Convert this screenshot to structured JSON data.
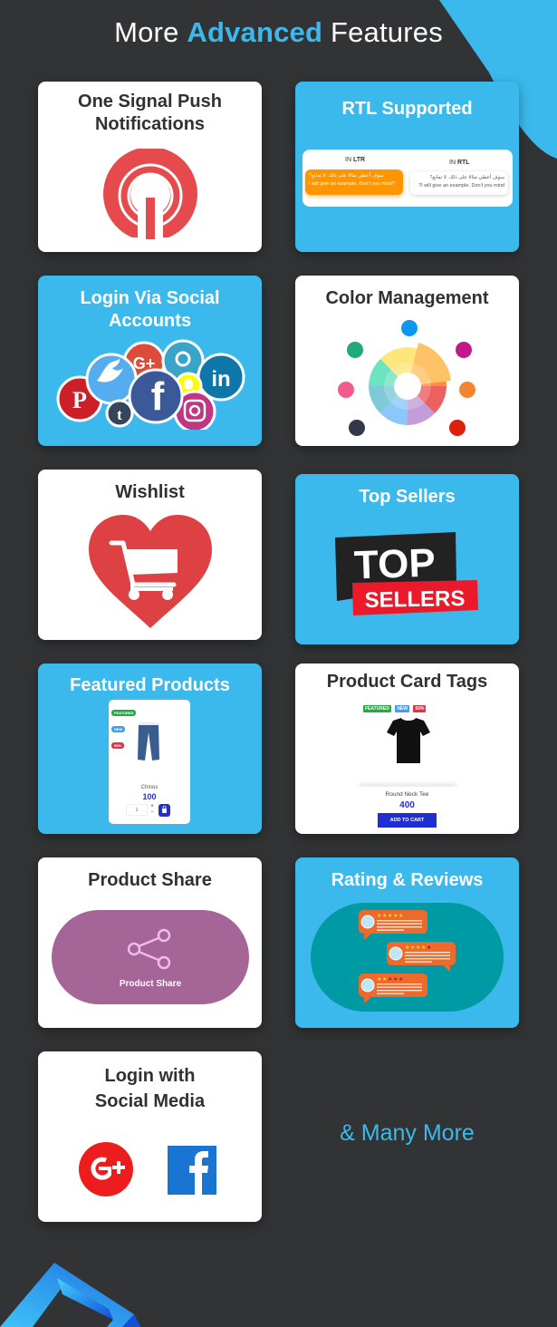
{
  "header": {
    "title_prefix": "More",
    "title_accent": "Advanced",
    "title_suffix": "Features"
  },
  "colors": {
    "background": "#313335",
    "accent_blue": "#3bb9ec",
    "card_white": "#ffffff",
    "title_dark": "#2f3133"
  },
  "features": [
    {
      "title_line1": "One Signal Push",
      "title_line2": "Notifications",
      "icon": "onesignal-bell-icon",
      "style": "white"
    },
    {
      "title": "RTL Supported",
      "icon": "rtl-demo",
      "style": "blue",
      "demo": {
        "ltr_label_prefix": "IN",
        "ltr_label_strong": "LTR",
        "rtl_label_prefix": "IN",
        "rtl_label_strong": "RTL",
        "ltr_arabic": "?سوف أعطي مثالا على ذلك. لا تمانع",
        "ltr_english": "I will give an example. Don't you mind?",
        "rtl_arabic": "سوف أعطي مثالا على ذلك. لا تمانع؟",
        "rtl_english": "?I will give an example. Don't you mind"
      }
    },
    {
      "title_line1": "Login Via Social",
      "title_line2": "Accounts",
      "icon": "social-bubbles-icon",
      "style": "blue"
    },
    {
      "title": "Color Management",
      "icon": "color-wheel-icon",
      "style": "white"
    },
    {
      "title": "Wishlist",
      "icon": "heart-cart-icon",
      "style": "white"
    },
    {
      "title": "Top Sellers",
      "icon": "top-sellers-badge",
      "style": "blue",
      "badge": {
        "line1": "TOP",
        "line2": "SELLERS"
      }
    },
    {
      "title": "Featured Products",
      "style": "blue",
      "product": {
        "tags": [
          "FEATURED",
          "NEW",
          "50%"
        ],
        "name": "Chinos",
        "price": "100",
        "qty": "1",
        "plus": "+",
        "minus": "−"
      }
    },
    {
      "title": "Product Card Tags",
      "style": "white",
      "product": {
        "tags": [
          "FEATURED",
          "NEW",
          "50%"
        ],
        "name": "Round Neck Tee",
        "price": "400",
        "button": "ADD TO CART"
      }
    },
    {
      "title": "Product Share",
      "style": "white",
      "button_label": "Product Share"
    },
    {
      "title": "Rating & Reviews",
      "style": "blue",
      "ratings": [
        5,
        4,
        2
      ]
    },
    {
      "title_line1": "Login with",
      "title_line2": "Social Media",
      "style": "white",
      "icons": [
        "google-plus-icon",
        "facebook-icon"
      ]
    }
  ],
  "footer_note": "& Many More"
}
